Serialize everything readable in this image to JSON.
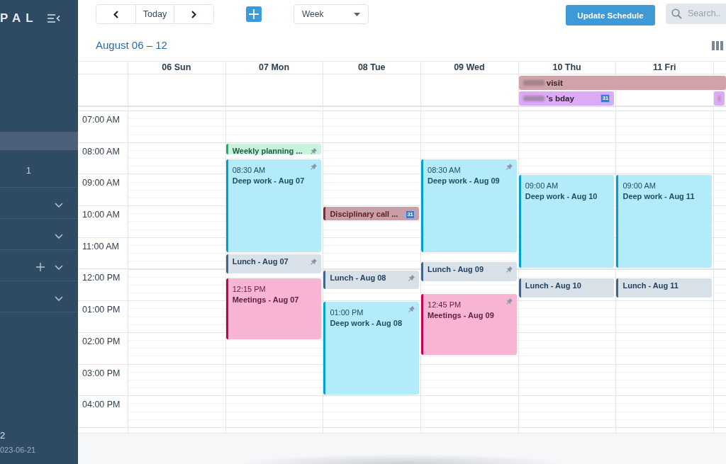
{
  "sidebar": {
    "logo": "PAL",
    "items": [
      {
        "kind": "link",
        "selected": true
      },
      {
        "kind": "link",
        "selected": false,
        "count": "1"
      },
      {
        "kind": "group",
        "selected": false,
        "expanded": false,
        "addable": false
      },
      {
        "kind": "group",
        "selected": false,
        "expanded": false,
        "addable": false
      },
      {
        "kind": "group",
        "selected": false,
        "expanded": false,
        "addable": true
      },
      {
        "kind": "group",
        "selected": false,
        "expanded": false,
        "addable": false
      }
    ],
    "footer": {
      "line_1": "2",
      "line_2": "023-06-21"
    }
  },
  "toolbar": {
    "today_button": "Today",
    "view_select": {
      "value": "Week"
    },
    "update_button": "Update Schedule",
    "search": {
      "placeholder": "Search.."
    }
  },
  "calendar": {
    "title": "August 06 – 12",
    "hours": [
      "07:00 AM",
      "08:00 AM",
      "09:00 AM",
      "10:00 AM",
      "11:00 AM",
      "12:00 PM",
      "01:00 PM",
      "02:00 PM",
      "03:00 PM",
      "04:00 PM"
    ],
    "days": [
      {
        "label": "06 Sun"
      },
      {
        "label": "07 Mon",
        "events": [
          {
            "title": "Weekly planning ...",
            "color": "#c8f3dd",
            "pinned": true
          },
          {
            "time": "08:30 AM",
            "title": "Deep work - Aug 07",
            "color": "#b3ebfb",
            "pinned": true
          },
          {
            "title": "Lunch - Aug 07",
            "color": "#d8e0e8",
            "pinned": true
          },
          {
            "time": "12:15 PM",
            "title": "Meetings - Aug 07",
            "color": "#f7b5d3",
            "pinned": false
          }
        ]
      },
      {
        "label": "08 Tue",
        "events": [
          {
            "title": "Disciplinary call ...",
            "color": "#c99ea4",
            "pinned": false,
            "badge": "31"
          },
          {
            "title": "Lunch - Aug 08",
            "color": "#d8e0e8",
            "pinned": true
          },
          {
            "time": "01:00 PM",
            "title": "Deep work - Aug 08",
            "color": "#b3ebfb",
            "pinned": true
          }
        ]
      },
      {
        "label": "09 Wed",
        "events": [
          {
            "time": "08:30 AM",
            "title": "Deep work - Aug 09",
            "color": "#b3ebfb",
            "pinned": true
          },
          {
            "title": "Lunch - Aug 09",
            "color": "#d8e0e8",
            "pinned": true
          },
          {
            "time": "12:45 PM",
            "title": "Meetings - Aug 09",
            "color": "#f7b5d3",
            "pinned": true
          }
        ]
      },
      {
        "label": "10 Thu",
        "all_day": [
          {
            "title": "visit",
            "redacted": true,
            "color": "#d1a3a9",
            "continues": true
          },
          {
            "title": "'s bday",
            "redacted": true,
            "color": "#ddabf5",
            "continues": false,
            "badge": "31"
          }
        ],
        "events": [
          {
            "time": "09:00 AM",
            "title": "Deep work - Aug 10",
            "color": "#b3ebfb",
            "pinned": false
          },
          {
            "title": "Lunch - Aug 10",
            "color": "#d8e0e8",
            "pinned": false
          }
        ]
      },
      {
        "label": "11 Fri",
        "events": [
          {
            "time": "09:00 AM",
            "title": "Deep work - Aug 11",
            "color": "#b3ebfb",
            "pinned": false
          },
          {
            "title": "Lunch - Aug 11",
            "color": "#d8e0e8",
            "pinned": false
          }
        ]
      },
      {
        "all_day": [
          {
            "redacted": true,
            "color": "#ddabf5",
            "continues": false
          }
        ]
      }
    ]
  }
}
